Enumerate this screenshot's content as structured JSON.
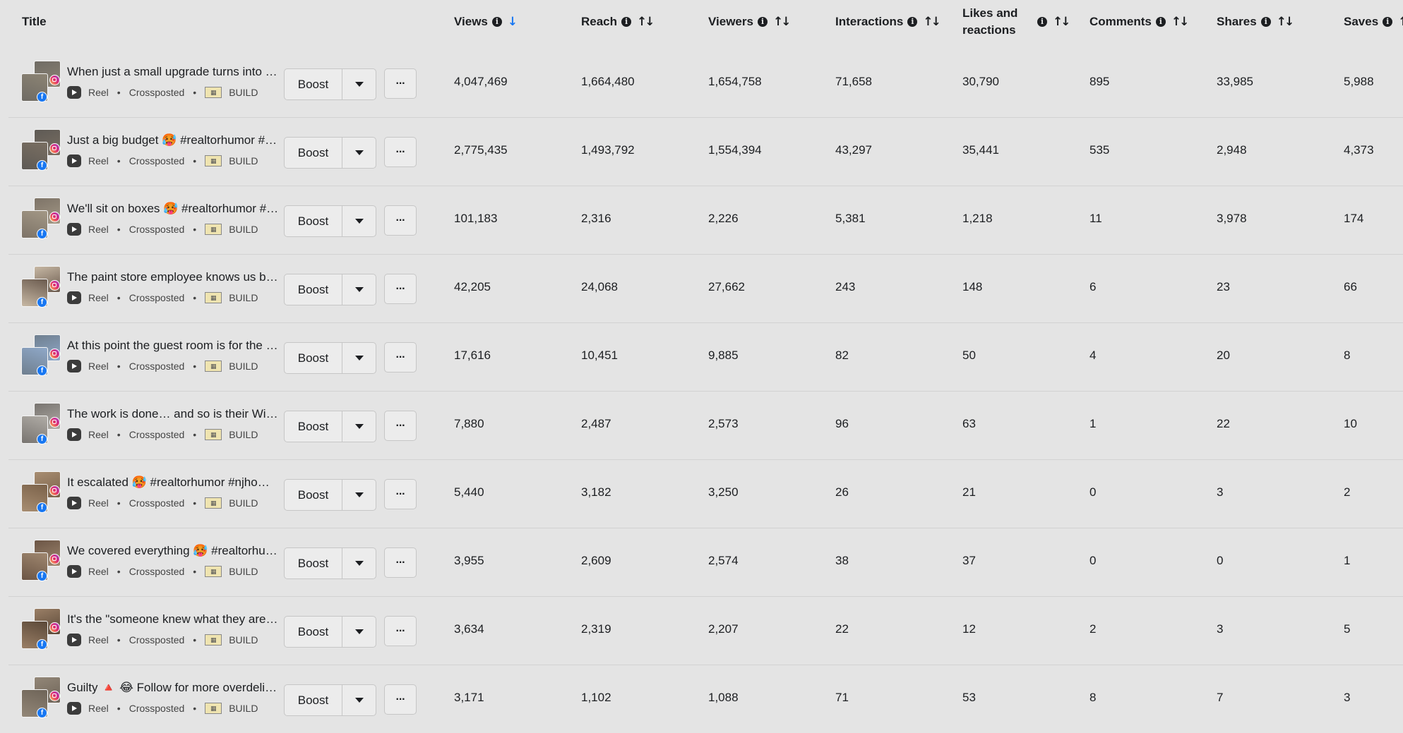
{
  "header": {
    "title": "Title",
    "columns": [
      {
        "label": "Views",
        "info": true,
        "sort": "desc"
      },
      {
        "label": "Reach",
        "info": true,
        "sort": "both"
      },
      {
        "label": "Viewers",
        "info": true,
        "sort": "both"
      },
      {
        "label": "Interactions",
        "info": true,
        "sort": "both"
      },
      {
        "label": "Likes and reactions",
        "info": true,
        "sort": "both"
      },
      {
        "label": "Comments",
        "info": true,
        "sort": "both"
      },
      {
        "label": "Shares",
        "info": true,
        "sort": "both"
      },
      {
        "label": "Saves",
        "info": true,
        "sort": "both"
      }
    ]
  },
  "labels": {
    "boost": "Boost",
    "more": "···",
    "type": "Reel",
    "status": "Crossposted",
    "dot": "•",
    "account": "BUILD",
    "info_glyph": "i",
    "sort_desc_glyph": "↓",
    "sort_both_glyph": "↑↓",
    "fb_glyph": "f",
    "page_glyph": "▦"
  },
  "rows": [
    {
      "title": "When just a small upgrade turns into a full remodel",
      "values": [
        "4,047,469",
        "1,664,480",
        "1,654,758",
        "71,658",
        "30,790",
        "895",
        "33,985",
        "5,988"
      ]
    },
    {
      "title": "Just a big budget 🥵 #realtorhumor #njhomes",
      "values": [
        "2,775,435",
        "1,493,792",
        "1,554,394",
        "43,297",
        "35,441",
        "535",
        "2,948",
        "4,373"
      ]
    },
    {
      "title": "We'll sit on boxes 🥵 #realtorhumor #njhomes",
      "values": [
        "101,183",
        "2,316",
        "2,226",
        "5,381",
        "1,218",
        "11",
        "3,978",
        "174"
      ]
    },
    {
      "title": "The paint store employee knows us by name",
      "values": [
        "42,205",
        "24,068",
        "27,662",
        "243",
        "148",
        "6",
        "23",
        "66"
      ]
    },
    {
      "title": "At this point the guest room is for the contractor",
      "values": [
        "17,616",
        "10,451",
        "9,885",
        "82",
        "50",
        "4",
        "20",
        "8"
      ]
    },
    {
      "title": "The work is done… and so is their Wi-Fi password",
      "values": [
        "7,880",
        "2,487",
        "2,573",
        "96",
        "63",
        "1",
        "22",
        "10"
      ]
    },
    {
      "title": "It escalated 🥵 #realtorhumor #njhomes",
      "values": [
        "5,440",
        "3,182",
        "3,250",
        "26",
        "21",
        "0",
        "3",
        "2"
      ]
    },
    {
      "title": "We covered everything 🥵 #realtorhumor",
      "values": [
        "3,955",
        "2,609",
        "2,574",
        "38",
        "37",
        "0",
        "0",
        "1"
      ]
    },
    {
      "title": "It's the \"someone knew what they are doing\"",
      "values": [
        "3,634",
        "2,319",
        "2,207",
        "22",
        "12",
        "2",
        "3",
        "5"
      ]
    },
    {
      "title": "Guilty 🔺 😂 Follow for more overdelivering",
      "values": [
        "3,171",
        "1,102",
        "1,088",
        "71",
        "53",
        "8",
        "7",
        "3"
      ]
    }
  ],
  "colors": {
    "background": "#e4e4e4",
    "accent_sort": "#1877f2",
    "facebook": "#1877f2",
    "row_divider": "#d2d2d2"
  }
}
